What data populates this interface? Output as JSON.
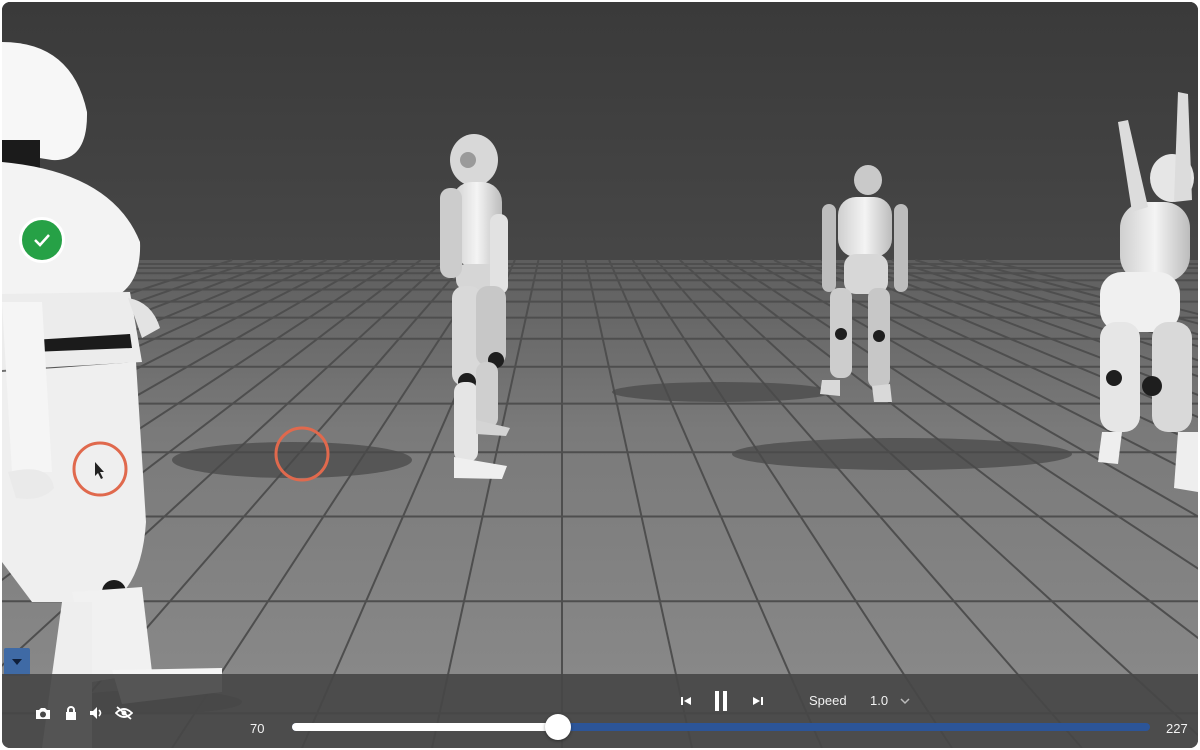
{
  "scene": {
    "characters": [
      {
        "name": "robot-near-left",
        "visible": true
      },
      {
        "name": "robot-walking-center",
        "visible": true
      },
      {
        "name": "robot-standing-right",
        "visible": true
      },
      {
        "name": "robot-dancing-far-right",
        "visible": true
      }
    ],
    "badge": "check-icon",
    "colors": {
      "selection_ring": "#e0694d",
      "check_badge": "#26a146",
      "timeline_track": "#2c5598"
    }
  },
  "player": {
    "frame_start": "70",
    "frame_end": "227",
    "speed_label": "Speed",
    "speed_value": "1.0",
    "progress_fraction": 0.31,
    "state": "playing",
    "icons": [
      "camera-icon",
      "lock-icon",
      "volume-icon",
      "visibility-off-icon",
      "skip-back-icon",
      "pause-icon",
      "skip-forward-icon",
      "chevron-down-icon"
    ]
  }
}
